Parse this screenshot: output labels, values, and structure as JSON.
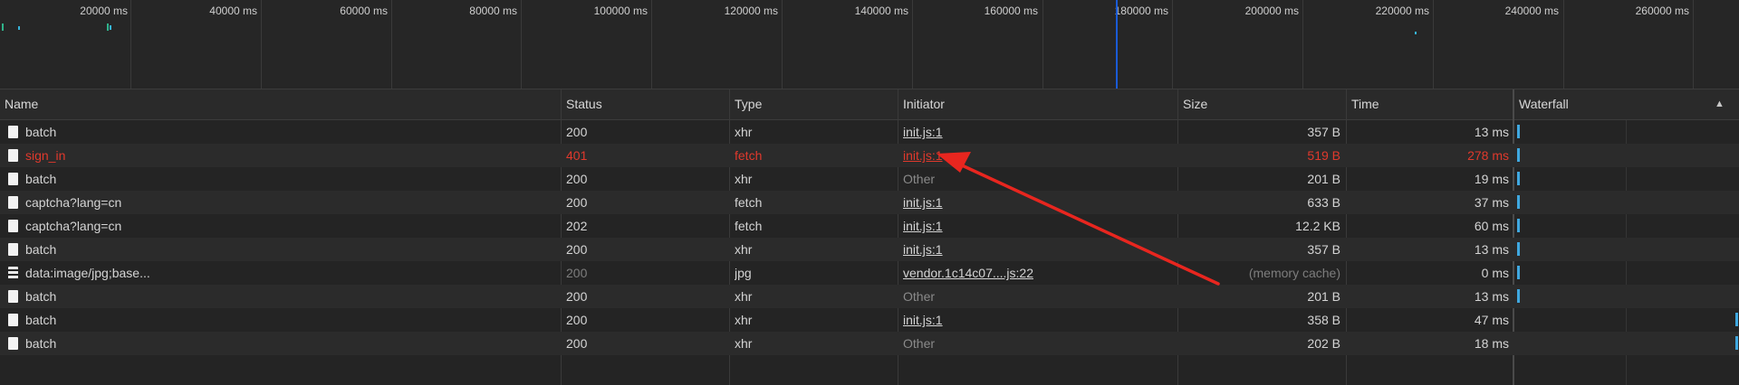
{
  "overview": {
    "ticks": [
      "20000 ms",
      "40000 ms",
      "60000 ms",
      "80000 ms",
      "100000 ms",
      "120000 ms",
      "140000 ms",
      "160000 ms",
      "180000 ms",
      "200000 ms",
      "220000 ms",
      "240000 ms",
      "260000 ms"
    ]
  },
  "columns": {
    "name": "Name",
    "status": "Status",
    "type": "Type",
    "initiator": "Initiator",
    "size": "Size",
    "time": "Time",
    "waterfall": "Waterfall",
    "sort_indicator": "▲"
  },
  "rows": [
    {
      "name": "batch",
      "status": "200",
      "type": "xhr",
      "initiator": "init.js:1",
      "size": "357 B",
      "time": "13 ms"
    },
    {
      "name": "sign_in",
      "status": "401",
      "type": "fetch",
      "initiator": "init.js:1",
      "size": "519 B",
      "time": "278 ms"
    },
    {
      "name": "batch",
      "status": "200",
      "type": "xhr",
      "initiator": "Other",
      "size": "201 B",
      "time": "19 ms"
    },
    {
      "name": "captcha?lang=cn",
      "status": "200",
      "type": "fetch",
      "initiator": "init.js:1",
      "size": "633 B",
      "time": "37 ms"
    },
    {
      "name": "captcha?lang=cn",
      "status": "202",
      "type": "fetch",
      "initiator": "init.js:1",
      "size": "12.2 KB",
      "time": "60 ms"
    },
    {
      "name": "batch",
      "status": "200",
      "type": "xhr",
      "initiator": "init.js:1",
      "size": "357 B",
      "time": "13 ms"
    },
    {
      "name": "data:image/jpg;base...",
      "status": "200",
      "type": "jpg",
      "initiator": "vendor.1c14c07....js:22",
      "size": "(memory cache)",
      "time": "0 ms"
    },
    {
      "name": "batch",
      "status": "200",
      "type": "xhr",
      "initiator": "Other",
      "size": "201 B",
      "time": "13 ms"
    },
    {
      "name": "batch",
      "status": "200",
      "type": "xhr",
      "initiator": "init.js:1",
      "size": "358 B",
      "time": "47 ms"
    },
    {
      "name": "batch",
      "status": "200",
      "type": "xhr",
      "initiator": "Other",
      "size": "202 B",
      "time": "18 ms"
    }
  ],
  "colors": {
    "error": "#e0392c",
    "playhead": "#1a5bd6",
    "waterfall_bar": "#3fa8e0",
    "annotation_arrow": "#e8261f"
  }
}
